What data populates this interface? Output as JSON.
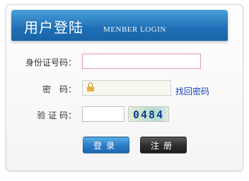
{
  "header": {
    "title_cn": "用户登陆",
    "title_en": "MENBER LOGIN"
  },
  "form": {
    "id_label": "身份证号码：",
    "password_label": "密　码：",
    "captcha_label": "验 证 码：",
    "id_value": "",
    "password_value": "",
    "captcha_value": "",
    "forgot_password": "找回密码",
    "captcha_text": "0484"
  },
  "buttons": {
    "login": "登录",
    "register": "注册"
  },
  "colors": {
    "header_blue": "#1f6fb6",
    "login_blue": "#2a7bc6",
    "register_dark": "#2d2d2d",
    "link_blue": "#1a3fbf"
  },
  "icons": {
    "password_field": "lock-icon"
  }
}
